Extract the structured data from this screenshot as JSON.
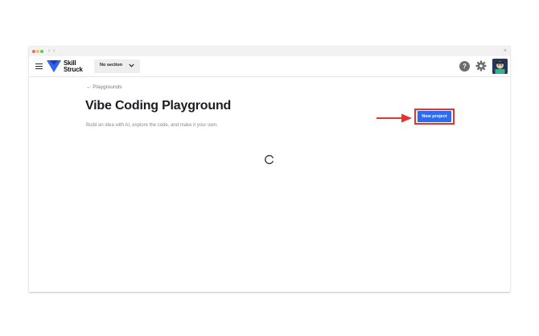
{
  "browser": {
    "back_glyph": "‹",
    "forward_glyph": "›",
    "close_glyph": "×"
  },
  "header": {
    "logo_line1": "Skill",
    "logo_line2": "Struck",
    "section_select": {
      "value": "No section"
    }
  },
  "page": {
    "breadcrumb": "← Playgrounds",
    "title": "Vibe Coding Playground",
    "subtitle": "Build an idea with AI, explore the code, and make it your own.",
    "new_project_label": "New project"
  },
  "colors": {
    "accent_blue": "#2e6bef",
    "annotation_red": "#e8332a",
    "logo_blue": "#2f64f0"
  },
  "icons": [
    "menu-icon",
    "skill-struck-logo-icon",
    "chevron-down-icon",
    "help-icon",
    "gear-icon",
    "avatar",
    "loading-spinner-icon",
    "annotation-arrow"
  ]
}
